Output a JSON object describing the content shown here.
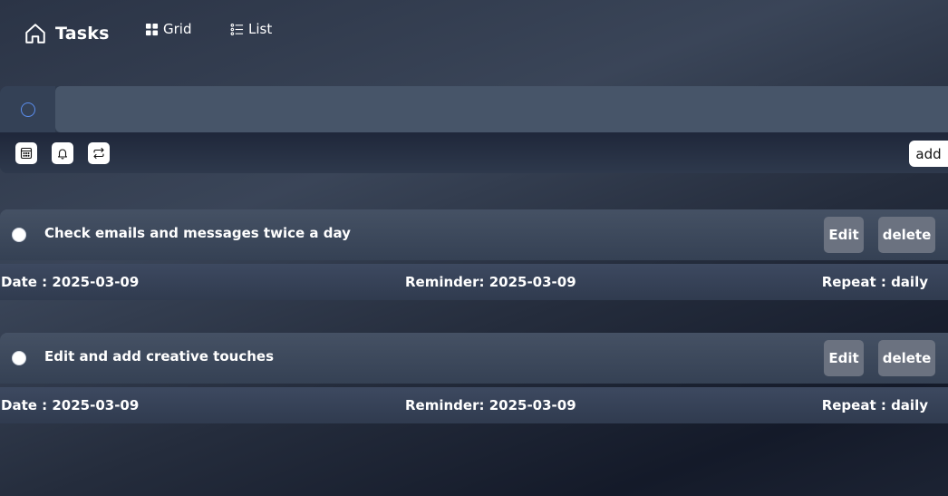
{
  "nav": {
    "title": "Tasks",
    "home_icon": "home-icon",
    "grid_label": "Grid",
    "grid_icon": "grid-icon",
    "list_label": "List",
    "list_icon": "list-icon"
  },
  "composer": {
    "input_value": "",
    "input_placeholder": "",
    "tools": [
      "calendar-icon",
      "bell-icon",
      "repeat-icon"
    ],
    "add_label": "add",
    "accent_color": "#5b8ff0"
  },
  "tasks": [
    {
      "title": "Check emails and messages twice a day",
      "edit_label": "Edit",
      "delete_label": "delete",
      "date": "Date : 2025-03-09",
      "reminder": "Reminder: 2025-03-09",
      "repeat": "Repeat : daily"
    },
    {
      "title": "Edit and add creative touches",
      "edit_label": "Edit",
      "delete_label": "delete",
      "date": "Date : 2025-03-09",
      "reminder": "Reminder: 2025-03-09",
      "repeat": "Repeat : daily"
    }
  ]
}
